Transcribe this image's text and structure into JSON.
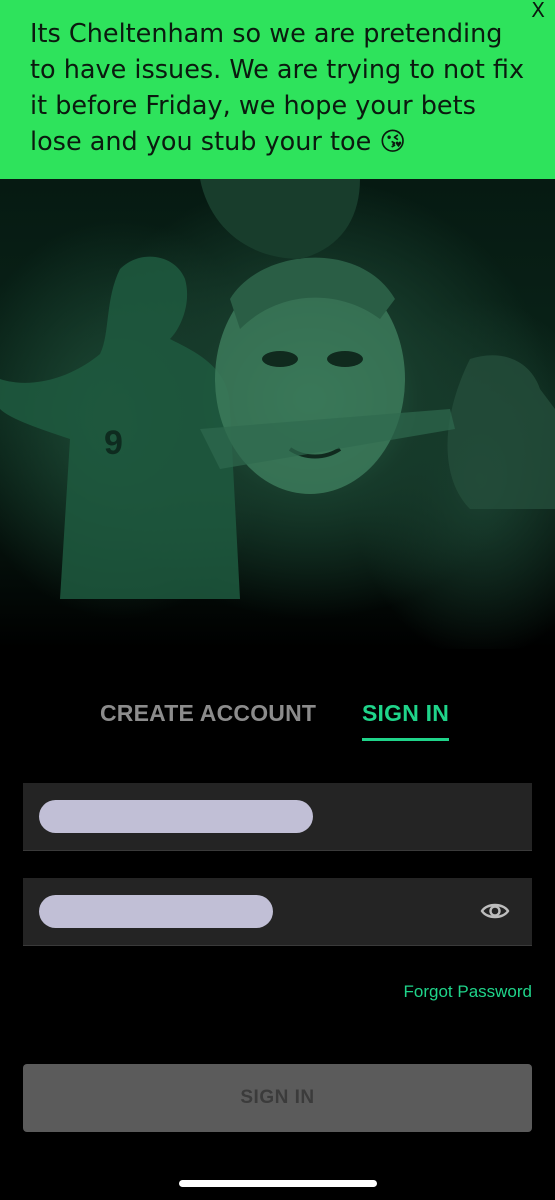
{
  "banner": {
    "message": "Its Cheltenham so we are pretending to have issues. We are trying to not fix it before Friday, we hope your bets lose and you stub your toe 😘",
    "close_label": "X",
    "background": "#2ee35c"
  },
  "hero": {
    "icon": "promo-collage-image"
  },
  "tabs": {
    "create_label": "CREATE ACCOUNT",
    "signin_label": "SIGN IN",
    "active": "signin",
    "accent": "#1fd48a"
  },
  "form": {
    "username_value": "",
    "password_value": "",
    "password_toggle_icon": "eye-icon"
  },
  "links": {
    "forgot_password": "Forgot Password"
  },
  "button": {
    "signin_label": "SIGN IN"
  }
}
